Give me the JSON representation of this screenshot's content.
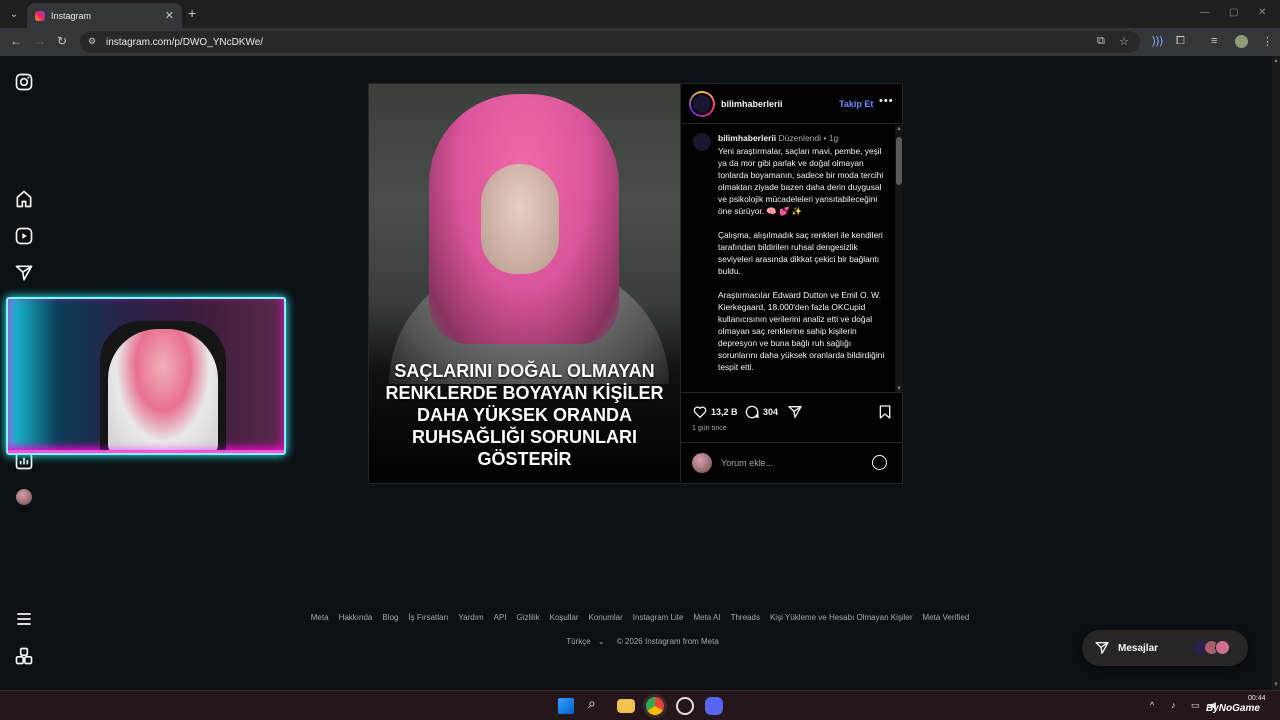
{
  "browser": {
    "tab_title": "Instagram",
    "tab_close": "✕",
    "new_tab": "+",
    "url": "instagram.com/p/DWO_YNcDKWe/"
  },
  "post": {
    "image_caption": "SAÇLARINI DOĞAL OLMAYAN\nRENKLERDE BOYAYAN KİŞİLER\nDAHA YÜKSEK ORANDA\nRUHSAĞLIĞI SORUNLARI\nGÖSTERİR",
    "username": "bilimhaberlerii",
    "follow_label": "Takip Et",
    "more_label": "•••",
    "comment": {
      "username": "bilimhaberlerii",
      "edited": "Düzenlendi",
      "sep": "•",
      "age": "1g",
      "paragraph1": "Yeni araştırmalar, saçları mavi, pembe, yeşil ya da mor gibi parlak ve doğal olmayan tonlarda boyamanın, sadece bir moda tercihi olmaktan ziyade bazen daha derin duygusal ve psikolojik mücadeleleri yansıtabileceğini öne sürüyor. 🧠 💕 ✨",
      "paragraph2": "Çalışma, alışılmadık saç renkleri ile kendileri tarafından bildirilen ruhsal dengesizlik seviyeleri arasında dikkat çekici bir bağlantı buldu.",
      "paragraph3": "Araştırmacılar Edward Dutton ve Emil O. W. Kierkegaard, 18.000'den fazla OKCupid kullanıcısının verilerini analiz etti ve doğal olmayan saç renklerine sahip kişilerin depresyon ve buna bağlı ruh sağlığı sorunlarını daha yüksek oranlarda bildirdiğini tespit etti."
    },
    "likes": "13,2 B",
    "comments_count": "304",
    "time_ago": "1 gün önce",
    "add_comment_placeholder": "Yorum ekle..."
  },
  "footer": {
    "links": [
      "Meta",
      "Hakkında",
      "Blog",
      "İş Fırsatları",
      "Yardım",
      "API",
      "Gizlilik",
      "Koşullar",
      "Konumlar",
      "Instagram Lite",
      "Meta AI",
      "Threads",
      "Kişi Yükleme ve Hesabı Olmayan Kişiler",
      "Meta Verified"
    ],
    "language": "Türkçe",
    "copyright": "© 2026 Instagram from Meta"
  },
  "messages": {
    "label": "Mesajlar"
  },
  "taskbar": {
    "time": "00:44"
  },
  "watermark": "ByNoGame",
  "colors": {
    "background": "#0b1014",
    "link_blue": "#6c8cff",
    "webcam_border": "#7ff6ff"
  }
}
